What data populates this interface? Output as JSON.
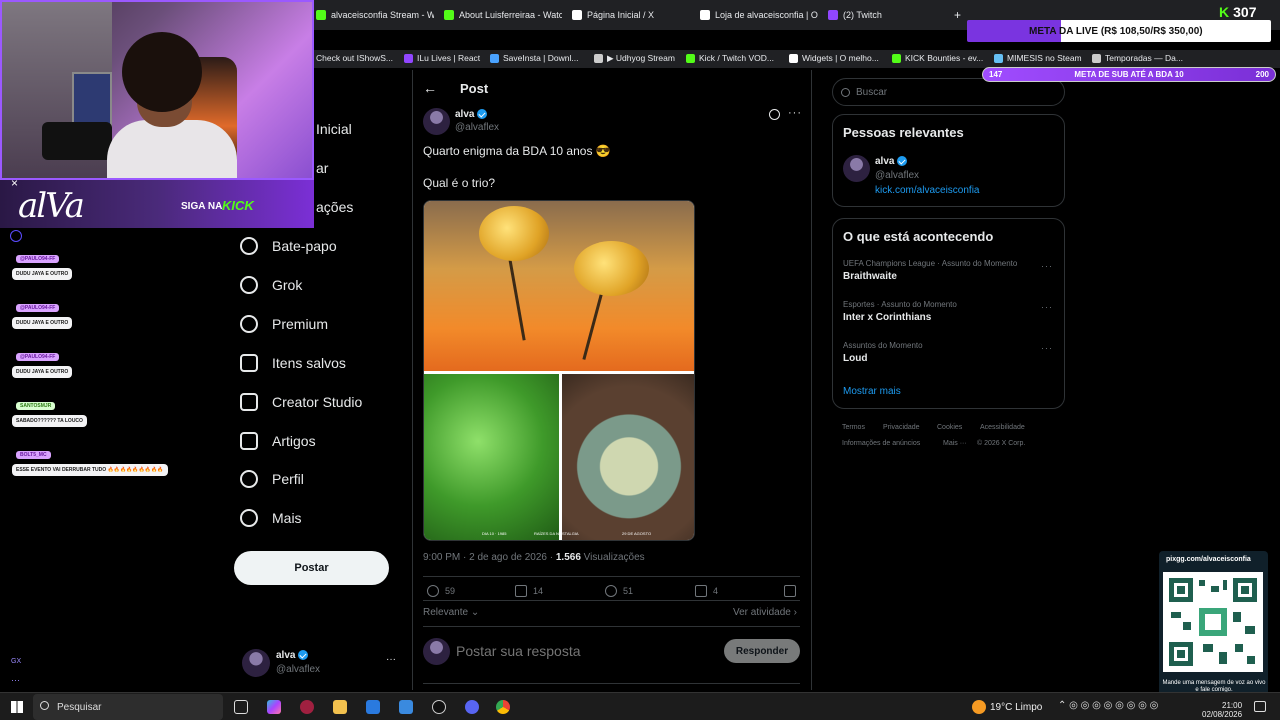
{
  "browser": {
    "tabs": [
      {
        "label": "alvaceisconfia Stream - W",
        "color": "#53fc18"
      },
      {
        "label": "About Luisferreiraa - Watc",
        "color": "#53fc18"
      },
      {
        "label": "Página Inicial / X",
        "color": "#ffffff"
      },
      {
        "label": "Loja de alvaceisconfia | O",
        "color": "#ffffff"
      },
      {
        "label": "(2) Twitch",
        "color": "#9146ff"
      }
    ],
    "bookmarks": [
      {
        "label": "Check out IShowS...",
        "color": "#ff0000"
      },
      {
        "label": "ILu Lives | React",
        "color": "#9146ff"
      },
      {
        "label": "SaveInsta | Downl...",
        "color": "#4aa3ff"
      },
      {
        "label": "▶ Udhyog Stream",
        "color": "#cccccc"
      },
      {
        "label": "Kick / Twitch VOD...",
        "color": "#53fc18"
      },
      {
        "label": "Widgets | O melho...",
        "color": "#ffffff"
      },
      {
        "label": "KICK Bounties - ev...",
        "color": "#53fc18"
      },
      {
        "label": "MIMESIS no Steam",
        "color": "#66c0f4"
      },
      {
        "label": "Temporadas — Da...",
        "color": "#cccccc"
      }
    ]
  },
  "overlay": {
    "signature": "alVa",
    "siga": "SIGA NA",
    "kick": "KICK",
    "close": "×",
    "kick_count": "307",
    "kick_k": "K",
    "meta_live": "META DA LIVE (R$ 108,50/R$ 350,00)",
    "meta_live_progress": 0.31,
    "meta_sub_label": "META DE SUB ATÉ A BDA 10",
    "meta_sub_current": "147",
    "meta_sub_target": "200",
    "chat": [
      {
        "user": "@PAULO94-FF",
        "msg": "DUDU JAYA E OUTRO"
      },
      {
        "user": "@PAULO94-FF",
        "msg": "DUDU JAYA E OUTRO"
      },
      {
        "user": "@PAULO94-FF",
        "msg": "DUDU JAYA E OUTRO"
      },
      {
        "user": "SANTOSMJR",
        "msg": "SABADO?????? TA LOUCO"
      },
      {
        "user": "BOLT5_MC",
        "msg": "ESSE EVENTO VAI DERRUBAR TUDO 🔥🔥🔥🔥🔥🔥🔥🔥🔥"
      }
    ],
    "qr_url": "pixgg.com/alvaceisconfia",
    "qr_note": "Mande uma mensagem de voz ao vivo e fale comigo.",
    "gx": "GX"
  },
  "nav": {
    "partial_items": [
      "Inicial",
      "ar",
      "ações"
    ],
    "items": [
      {
        "label": "Bate-papo",
        "icon": "chat-icon"
      },
      {
        "label": "Grok",
        "icon": "grok-icon"
      },
      {
        "label": "Premium",
        "icon": "premium-icon"
      },
      {
        "label": "Itens salvos",
        "icon": "bookmark-icon"
      },
      {
        "label": "Creator Studio",
        "icon": "rocket-icon"
      },
      {
        "label": "Artigos",
        "icon": "article-icon"
      },
      {
        "label": "Perfil",
        "icon": "profile-icon"
      },
      {
        "label": "Mais",
        "icon": "more-icon"
      }
    ],
    "post_button": "Postar",
    "account_name": "alva",
    "account_handle": "@alvaflex",
    "account_more": "···"
  },
  "post": {
    "header": "Post",
    "back": "←",
    "author_name": "alva",
    "author_handle": "@alvaflex",
    "more": "···",
    "line1": "Quarto enigma da BDA 10 anos 😎",
    "line2": "Qual é o trio?",
    "captions": [
      "DIA 10 · 1985",
      "RAÍZES DA NOSTALGIA",
      "29 DE AGOSTO"
    ],
    "time": "9:00 PM · 2 de ago de 2026 · ",
    "views_count": "1.566",
    "views_label": " Visualizações",
    "replies": "59",
    "reposts": "14",
    "likes": "51",
    "bookmarks": "4",
    "relevant": "Relevante",
    "see_activity": "Ver atividade ›",
    "reply_placeholder": "Postar sua resposta",
    "reply_button": "Responder"
  },
  "sidebar": {
    "search_placeholder": "Buscar",
    "relevant_title": "Pessoas relevantes",
    "person_name": "alva",
    "person_handle": "@alvaflex",
    "person_link": "kick.com/alvaceisconfia",
    "trending_title": "O que está acontecendo",
    "trends": [
      {
        "context": "UEFA Champions League · Assunto do Momento",
        "name": "Braithwaite"
      },
      {
        "context": "Esportes · Assunto do Momento",
        "name": "Inter x Corinthians"
      },
      {
        "context": "Assuntos do Momento",
        "name": "Loud"
      }
    ],
    "show_more": "Mostrar mais",
    "footer": [
      "Termos",
      "Privacidade",
      "Cookies",
      "Acessibilidade",
      "Informações de anúncios",
      "Mais ···",
      "© 2026 X Corp."
    ]
  },
  "taskbar": {
    "search": "Pesquisar",
    "weather": "19°C  Limpo",
    "time": "21:00",
    "date": "02/08/2026"
  },
  "colors": {
    "accent": "#1d9bf0",
    "kick": "#53fc18",
    "purple": "#7a34e0"
  }
}
